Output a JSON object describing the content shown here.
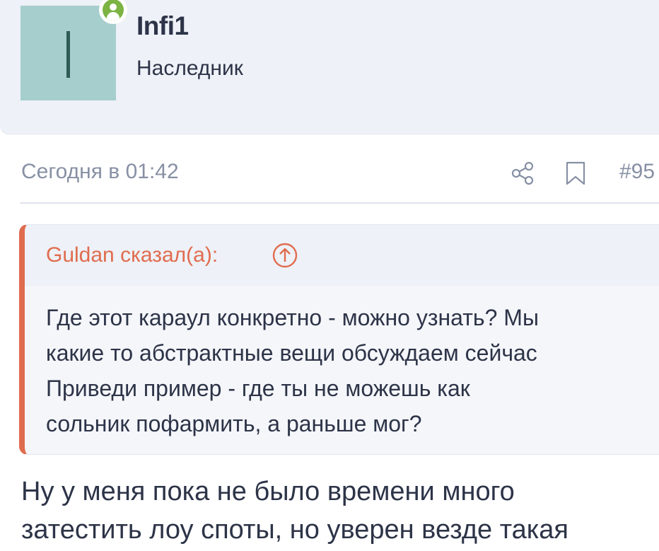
{
  "user": {
    "name": "Infi1",
    "title": "Наследник",
    "avatar_letter": "I",
    "status": "online"
  },
  "post": {
    "date": "Сегодня в 01:42",
    "number": "#95",
    "actions": [
      "share-icon",
      "bookmark-icon"
    ]
  },
  "quote": {
    "author": "Guldan сказал(а):",
    "jump_icon": "arrow-up-circle-icon",
    "lines": [
      "Где этот караул конкретно - можно узнать? Мы",
      "какие то абстрактные вещи обсуждаем сейчас",
      "Приведи пример - где ты не можешь как",
      "сольник пофармить, а раньше мог?"
    ]
  },
  "reply": {
    "lines": [
      "Ну у меня пока не было времени много",
      "затестить лоу споты, но уверен везде такая"
    ]
  },
  "colors": {
    "accent": "#e06c4f",
    "text": "#2d3448",
    "muted": "#8790a4",
    "avatar_bg": "#a6cecd",
    "online": "#7cb342"
  }
}
